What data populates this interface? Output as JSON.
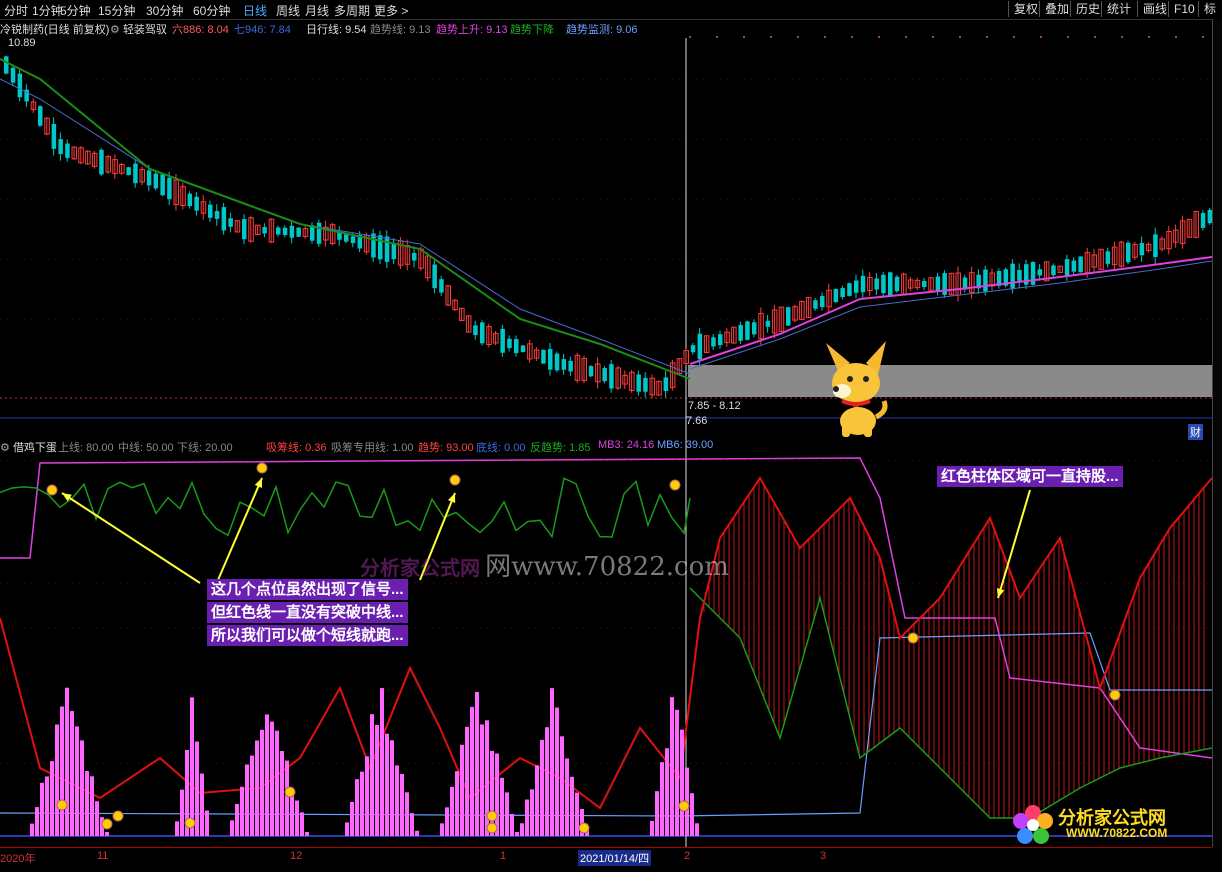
{
  "toolbar": {
    "periods": [
      "分时",
      "1分钟",
      "5分钟",
      "15分钟",
      "30分钟",
      "60分钟",
      "日线",
      "周线",
      "月线",
      "多周期",
      "更多 >"
    ],
    "active": "日线",
    "right_buttons": [
      "复权",
      "叠加",
      "历史",
      "统计",
      "画线",
      "F10",
      "标"
    ]
  },
  "upper": {
    "stock_title": "冷锐制药(日线 前复权)",
    "indicator_name": "轻装驾驭",
    "v6": "六886: 8.04",
    "v7": "七946: 7.84",
    "rixing": "日行线: 9.54",
    "qushixian": "趋势线: 9.13",
    "up": "趋势上升: 9.13",
    "down": "趋势下降",
    "monitor": "趋势监测: 9.06",
    "high_label": "10.89",
    "range_label": "7.85 - 8.12",
    "low_label": "7.66",
    "right_tag": "财"
  },
  "lower": {
    "indicator_name": "借鸡下蛋",
    "upper_line": "上线: 80.00",
    "mid_line": "中线: 50.00",
    "lower_line": "下线: 20.00",
    "xichou": "吸筹线: 0.36",
    "xichou_special": "吸筹专用线: 1.00",
    "trend": "趋势: 93.00",
    "dixian": "底线: 0.00",
    "reverse": "反趋势: 1.85",
    "mb3": "MB3: 24.16",
    "mb6": "MB6: 39.00"
  },
  "annotations": {
    "left_lines": [
      "这几个点位虽然出现了信号...",
      "但红色线一直没有突破中线...",
      "所以我们可以做个短线就跑..."
    ],
    "right_line": "红色柱体区域可一直持股..."
  },
  "watermarks": {
    "site_cn": "分析家公式网",
    "site_url": "www.70822.com",
    "site_url_small": "WWW.70822.COM",
    "net_prefix": "网"
  },
  "xaxis": {
    "labels": [
      "2020年",
      "11",
      "12",
      "1",
      "2021/01/14/四",
      "2",
      "3"
    ]
  },
  "colors": {
    "up_candle": "#ff3b3b",
    "down_candle": "#00c8c8",
    "ma_green": "#1a8c1a",
    "ma_magenta": "#e040e0",
    "ma_blue": "#4a6ad0",
    "hist_pink": "#ff66ff",
    "accent": "#4aa8ff"
  }
}
